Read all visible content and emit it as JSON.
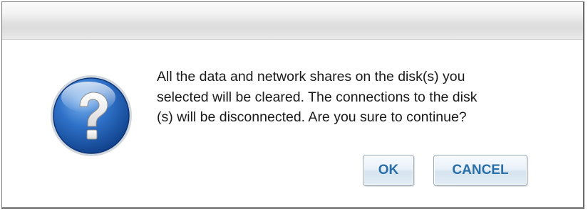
{
  "dialog": {
    "icon": "question-icon",
    "message": "All the data and network shares on the disk(s) you\nselected will be cleared. The connections to the disk\n(s) will be disconnected. Are you sure to continue?",
    "ok_label": "OK",
    "cancel_label": "CANCEL"
  },
  "colors": {
    "button_text": "#2a6fa8",
    "icon_blue": "#1f5fb5"
  }
}
